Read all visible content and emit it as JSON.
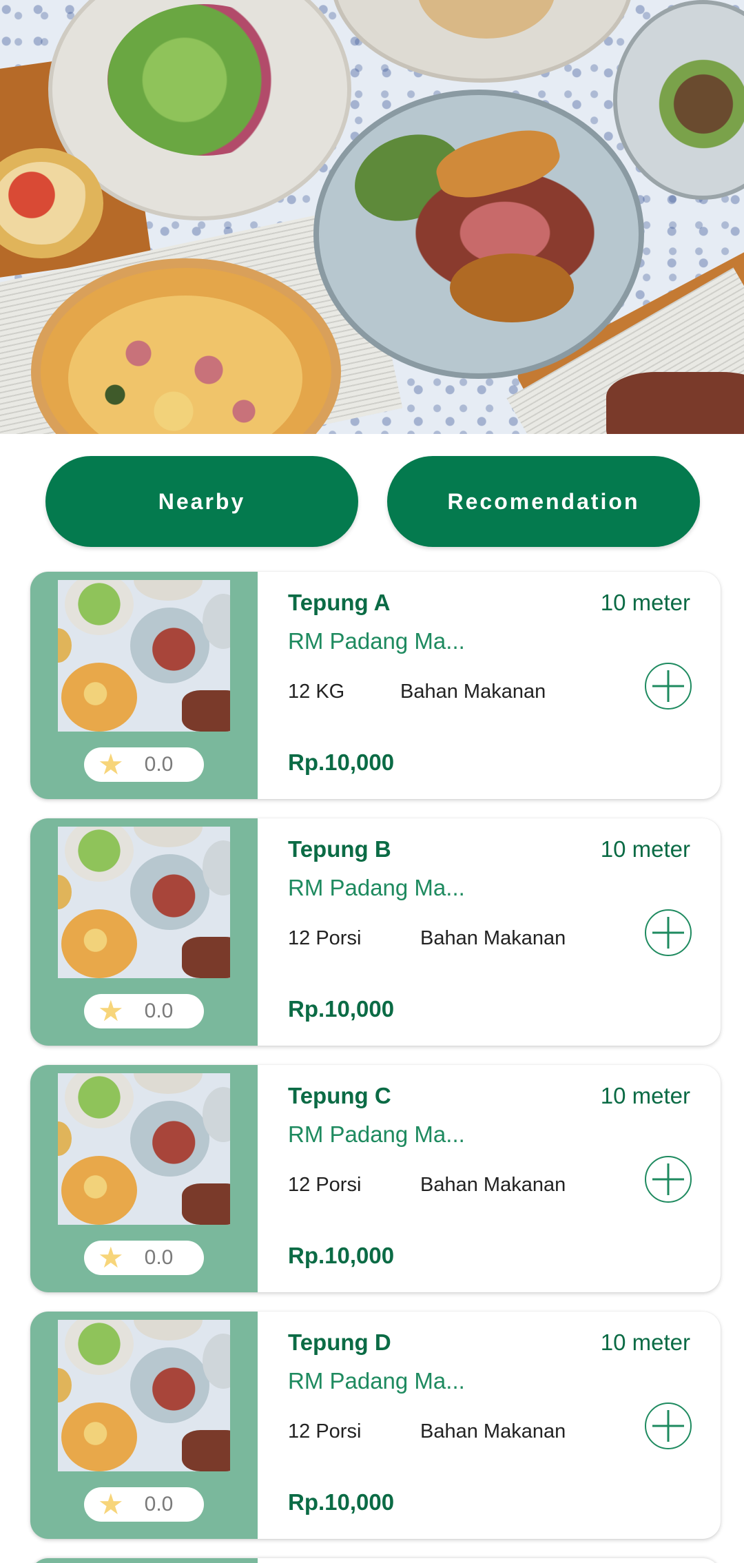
{
  "hero": {
    "image": "food-banner"
  },
  "tabs": [
    {
      "label": "Nearby"
    },
    {
      "label": "Recomendation"
    }
  ],
  "products": [
    {
      "name": "Tepung A",
      "distance": "10 meter",
      "store": "RM Padang Ma...",
      "quantity": "12 KG",
      "category": "Bahan Makanan",
      "price": "Rp.10,000",
      "rating": "0.0"
    },
    {
      "name": "Tepung B",
      "distance": "10 meter",
      "store": "RM Padang Ma...",
      "quantity": "12 Porsi",
      "category": "Bahan Makanan",
      "price": "Rp.10,000",
      "rating": "0.0"
    },
    {
      "name": "Tepung C",
      "distance": "10 meter",
      "store": "RM Padang Ma...",
      "quantity": "12 Porsi",
      "category": "Bahan Makanan",
      "price": "Rp.10,000",
      "rating": "0.0"
    },
    {
      "name": "Tepung D",
      "distance": "10 meter",
      "store": "RM Padang Ma...",
      "quantity": "12 Porsi",
      "category": "Bahan Makanan",
      "price": "Rp.10,000",
      "rating": "0.0"
    }
  ],
  "colors": {
    "primary": "#047a4e",
    "card_accent": "#7ab89c",
    "text_green": "#0b6b45",
    "star": "#f7d57a"
  }
}
